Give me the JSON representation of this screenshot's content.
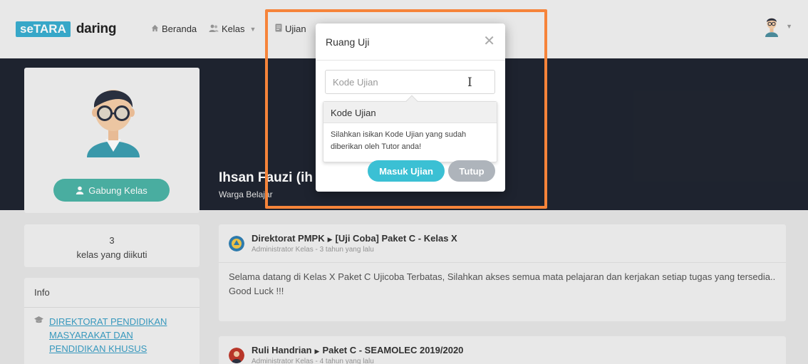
{
  "navbar": {
    "logo_tag": "seTARA",
    "logo_word": "daring",
    "items": [
      {
        "label": "Beranda",
        "icon": "home-icon"
      },
      {
        "label": "Kelas",
        "icon": "users-icon"
      },
      {
        "label": "Ujian",
        "icon": "document-icon"
      }
    ]
  },
  "profile": {
    "name": "Ihsan Fauzi (ih",
    "role": "Warga Belajar",
    "join_label": "Gabung Kelas"
  },
  "stats": {
    "count": "3",
    "label": "kelas yang diikuti"
  },
  "info": {
    "title": "Info",
    "link": "DIREKTORAT PENDIDIKAN MASYARAKAT DAN PENDIDIKAN KHUSUS"
  },
  "posts": [
    {
      "author": "Direktorat PMPK",
      "target": "[Uji Coba] Paket C - Kelas X",
      "meta": "Administrator Kelas - 3 tahun yang lalu",
      "body": "Selama datang di Kelas X Paket C Ujicoba Terbatas, Silahkan akses semua mata pelajaran dan kerjakan setiap tugas yang tersedia.. Good Luck !!!"
    },
    {
      "author": "Ruli Handrian",
      "target": "Paket C - SEAMOLEC 2019/2020",
      "meta": "Administrator Kelas - 4 tahun yang lalu"
    }
  ],
  "modal": {
    "title": "Ruang Uji",
    "close_symbol": "✕",
    "input_placeholder": "Kode Ujian",
    "tooltip_title": "Kode Ujian",
    "tooltip_body": "Silahkan isikan Kode Ujian yang sudah diberikan oleh Tutor anda!",
    "submit_label": "Masuk Ujian",
    "cancel_label": "Tutup"
  },
  "colors": {
    "highlight": "#f6843a",
    "hero_bg": "#202531",
    "accent_teal": "#3bc0d4",
    "join_green": "#4cb5a7",
    "link_blue": "#3a9fc5"
  }
}
